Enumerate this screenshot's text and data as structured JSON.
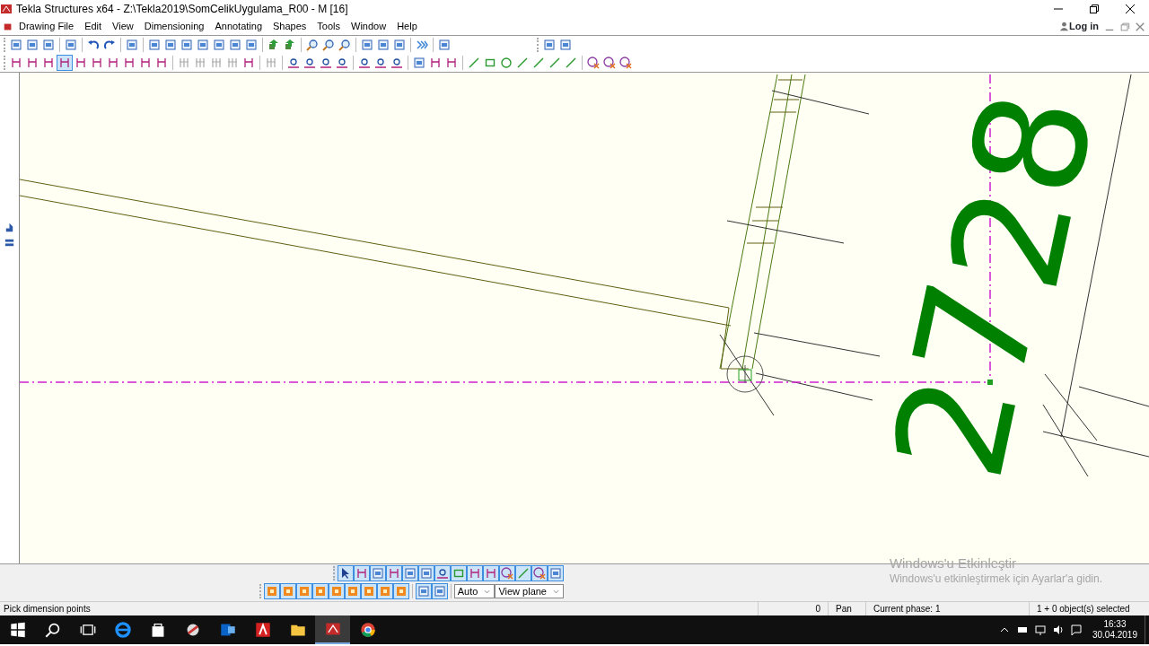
{
  "window": {
    "title": "Tekla Structures x64 - Z:\\Tekla2019\\SomCelikUygulama_R00  - M  [16]"
  },
  "menu": [
    "Drawing File",
    "Edit",
    "View",
    "Dimensioning",
    "Annotating",
    "Shapes",
    "Tools",
    "Window",
    "Help"
  ],
  "login": {
    "label": "Log in"
  },
  "toolbars": [
    {
      "groups": [
        [
          {
            "kind": "doc",
            "selected": false
          },
          {
            "kind": "doc",
            "selected": false
          },
          {
            "kind": "doc",
            "selected": false
          }
        ],
        [
          {
            "kind": "doc",
            "selected": false
          }
        ],
        [
          {
            "kind": "undo",
            "selected": false
          },
          {
            "kind": "redo",
            "selected": false
          }
        ],
        [
          {
            "kind": "doc",
            "selected": false
          }
        ],
        [
          {
            "kind": "doc",
            "selected": false
          },
          {
            "kind": "doc",
            "selected": false
          },
          {
            "kind": "doc",
            "selected": false
          },
          {
            "kind": "doc",
            "selected": false
          },
          {
            "kind": "doc",
            "selected": false
          },
          {
            "kind": "doc",
            "selected": false
          },
          {
            "kind": "doc",
            "selected": false
          }
        ],
        [
          {
            "kind": "arrow",
            "selected": false
          },
          {
            "kind": "arrow",
            "selected": false
          }
        ],
        [
          {
            "kind": "zoom",
            "selected": false
          },
          {
            "kind": "zoom",
            "selected": false
          },
          {
            "kind": "zoom",
            "selected": false
          }
        ],
        [
          {
            "kind": "doc",
            "selected": false
          },
          {
            "kind": "doc",
            "selected": false
          },
          {
            "kind": "doc",
            "selected": false
          }
        ],
        [
          {
            "kind": "more",
            "selected": false
          }
        ],
        [
          {
            "kind": "doc",
            "selected": false
          }
        ]
      ],
      "extra": [
        [
          {
            "kind": "doc",
            "selected": false
          },
          {
            "kind": "doc",
            "selected": false
          }
        ]
      ]
    },
    {
      "groups": [
        [
          {
            "kind": "dim",
            "selected": false
          },
          {
            "kind": "dim",
            "selected": false
          },
          {
            "kind": "dim",
            "selected": false
          },
          {
            "kind": "dim",
            "selected": true
          },
          {
            "kind": "dim",
            "selected": false
          },
          {
            "kind": "dim",
            "selected": false
          },
          {
            "kind": "dim",
            "selected": false
          },
          {
            "kind": "dim",
            "selected": false
          },
          {
            "kind": "dim",
            "selected": false
          },
          {
            "kind": "dim",
            "selected": false
          }
        ],
        [
          {
            "kind": "grey",
            "selected": false
          },
          {
            "kind": "grey",
            "selected": false
          },
          {
            "kind": "grey",
            "selected": false
          },
          {
            "kind": "grey",
            "selected": false
          },
          {
            "kind": "dim",
            "selected": false
          }
        ],
        [
          {
            "kind": "grey",
            "selected": false
          }
        ],
        [
          {
            "kind": "mark",
            "selected": false
          },
          {
            "kind": "mark",
            "selected": false
          },
          {
            "kind": "mark",
            "selected": false
          },
          {
            "kind": "mark",
            "selected": false
          }
        ],
        [
          {
            "kind": "mark",
            "selected": false
          },
          {
            "kind": "mark",
            "selected": false
          },
          {
            "kind": "mark",
            "selected": false
          }
        ],
        [
          {
            "kind": "doc",
            "selected": false
          },
          {
            "kind": "dim",
            "selected": false
          },
          {
            "kind": "dim",
            "selected": false
          }
        ],
        [
          {
            "kind": "line",
            "selected": false
          },
          {
            "kind": "rect",
            "selected": false
          },
          {
            "kind": "circle",
            "selected": false
          },
          {
            "kind": "line",
            "selected": false
          },
          {
            "kind": "line",
            "selected": false
          },
          {
            "kind": "line",
            "selected": false
          },
          {
            "kind": "line",
            "selected": false
          }
        ],
        [
          {
            "kind": "cancel",
            "selected": false
          },
          {
            "kind": "cancel",
            "selected": false
          },
          {
            "kind": "cancel",
            "selected": false
          }
        ]
      ]
    }
  ],
  "drawing": {
    "labels": [
      "28",
      "27"
    ]
  },
  "select_toolbar": [
    {
      "kind": "pointer",
      "selected": true
    },
    {
      "kind": "dim",
      "selected": true
    },
    {
      "kind": "doc",
      "selected": true
    },
    {
      "kind": "dim",
      "selected": true
    },
    {
      "kind": "doc",
      "selected": true
    },
    {
      "kind": "doc",
      "selected": true
    },
    {
      "kind": "mark",
      "selected": true
    },
    {
      "kind": "rect",
      "selected": true
    },
    {
      "kind": "dim",
      "selected": true
    },
    {
      "kind": "dim",
      "selected": true
    },
    {
      "kind": "cancel",
      "selected": true
    },
    {
      "kind": "line",
      "selected": true
    },
    {
      "kind": "cancel",
      "selected": true
    },
    {
      "kind": "doc",
      "selected": true
    }
  ],
  "snap_toolbar": {
    "buttons": [
      {
        "kind": "snap",
        "selected": true
      },
      {
        "kind": "snap",
        "selected": true
      },
      {
        "kind": "snap",
        "selected": true
      },
      {
        "kind": "snap",
        "selected": true
      },
      {
        "kind": "snap",
        "selected": true
      },
      {
        "kind": "snap",
        "selected": true
      },
      {
        "kind": "snap",
        "selected": true
      },
      {
        "kind": "snap",
        "selected": true
      },
      {
        "kind": "snap",
        "selected": true
      },
      {
        "kind": "doc",
        "selected": true
      },
      {
        "kind": "doc",
        "selected": true
      }
    ],
    "combos": [
      {
        "value": "Auto"
      },
      {
        "value": "View plane"
      }
    ]
  },
  "activation": {
    "title": "Windows'u Etkinleştir",
    "text": "Windows'u etkinleştirmek için Ayarlar'a gidin."
  },
  "status_bar": {
    "prompt": "Pick dimension points",
    "count": "0",
    "mode": "Pan",
    "phase": "Current phase: 1",
    "selection": "1 + 0 object(s) selected"
  },
  "taskbar": {
    "time": "16:33",
    "date": "30.04.2019"
  }
}
